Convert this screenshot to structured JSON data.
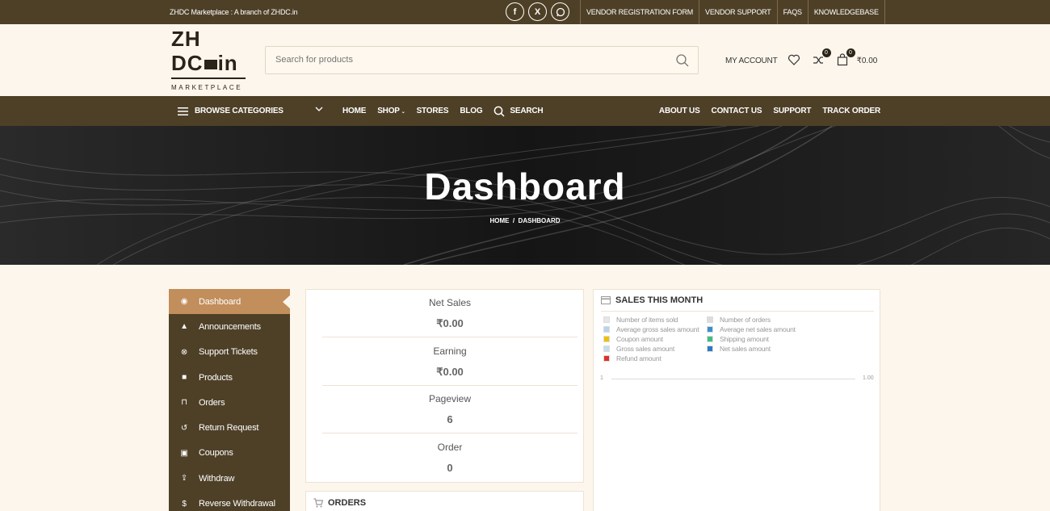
{
  "topbar": {
    "tagline": "ZHDC Marketplace : A branch of ZHDC.in",
    "social": [
      {
        "icon": "facebook-icon",
        "glyph": "f"
      },
      {
        "icon": "x-twitter-icon",
        "glyph": "X"
      },
      {
        "icon": "whatsapp-icon",
        "glyph": "◌"
      }
    ],
    "links": [
      "VENDOR REGISTRATION FORM",
      "VENDOR SUPPORT",
      "FAQS",
      "KNOWLEDGEBASE"
    ]
  },
  "header": {
    "logo": {
      "line1": "ZH",
      "line2": "DC",
      "line2b": "in",
      "line3": "MARKETPLACE"
    },
    "search_placeholder": "Search for products",
    "my_account": "MY ACCOUNT",
    "compare_count": "0",
    "cart_count": "0",
    "cart_total": "₹0.00"
  },
  "nav": {
    "browse": "BROWSE CATEGORIES",
    "left": [
      "HOME",
      "SHOP",
      "STORES",
      "BLOG",
      "SEARCH"
    ],
    "right": [
      "ABOUT US",
      "CONTACT US",
      "SUPPORT",
      "TRACK ORDER"
    ]
  },
  "hero": {
    "title": "Dashboard",
    "breadcrumb": "HOME  /  DASHBOARD"
  },
  "sidebar": {
    "items": [
      {
        "label": "Dashboard",
        "icon": "dashboard-icon",
        "glyph": "◉",
        "active": true
      },
      {
        "label": "Announcements",
        "icon": "bell-icon",
        "glyph": "▲"
      },
      {
        "label": "Support Tickets",
        "icon": "lifebuoy-icon",
        "glyph": "⊗"
      },
      {
        "label": "Products",
        "icon": "briefcase-icon",
        "glyph": "■"
      },
      {
        "label": "Orders",
        "icon": "cart-icon",
        "glyph": "⊓"
      },
      {
        "label": "Return Request",
        "icon": "undo-icon",
        "glyph": "↺"
      },
      {
        "label": "Coupons",
        "icon": "gift-icon",
        "glyph": "▣"
      },
      {
        "label": "Withdraw",
        "icon": "upload-icon",
        "glyph": "⇪"
      },
      {
        "label": "Reverse Withdrawal",
        "icon": "dollar-icon",
        "glyph": "$"
      }
    ]
  },
  "stats": [
    {
      "label": "Net Sales",
      "value": "₹0.00"
    },
    {
      "label": "Earning",
      "value": "₹0.00"
    },
    {
      "label": "Pageview",
      "value": "6"
    },
    {
      "label": "Order",
      "value": "0"
    }
  ],
  "orders_title": "ORDERS",
  "sales": {
    "title": "SALES THIS MONTH",
    "legend": [
      {
        "label": "Number of items sold",
        "color": "#e6e6e6"
      },
      {
        "label": "Number of orders",
        "color": "#dcdcdc"
      },
      {
        "label": "Average gross sales amount",
        "color": "#b9d3ea"
      },
      {
        "label": "Average net sales amount",
        "color": "#3a8fd0"
      },
      {
        "label": "Coupon amount",
        "color": "#f0c000"
      },
      {
        "label": "Shipping amount",
        "color": "#3fbf7f"
      },
      {
        "label": "Gross sales amount",
        "color": "#c7dcec"
      },
      {
        "label": "Net sales amount",
        "color": "#2b7bc6"
      },
      {
        "label": "Refund amount",
        "color": "#e0302a"
      }
    ],
    "axis_left": "1",
    "axis_right": "1.00"
  }
}
